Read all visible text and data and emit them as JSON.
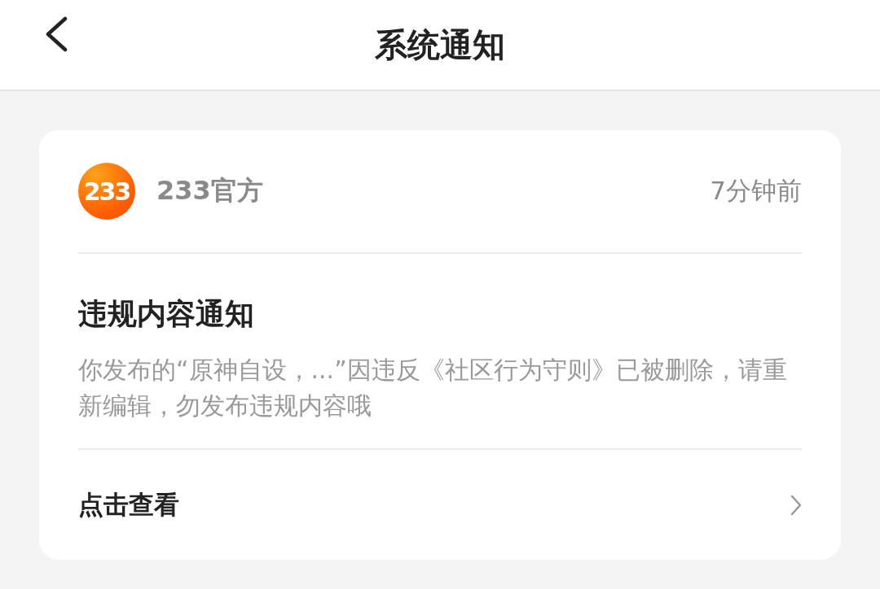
{
  "header": {
    "title": "系统通知"
  },
  "notification": {
    "sender": {
      "logo_text": "233",
      "name": "233官方"
    },
    "time": "7分钟前",
    "title": "违规内容通知",
    "body": "你发布的“原神自设，...”因违反《社区行为守则》已被删除，请重新编辑，勿发布违规内容哦",
    "action": "点击查看"
  }
}
